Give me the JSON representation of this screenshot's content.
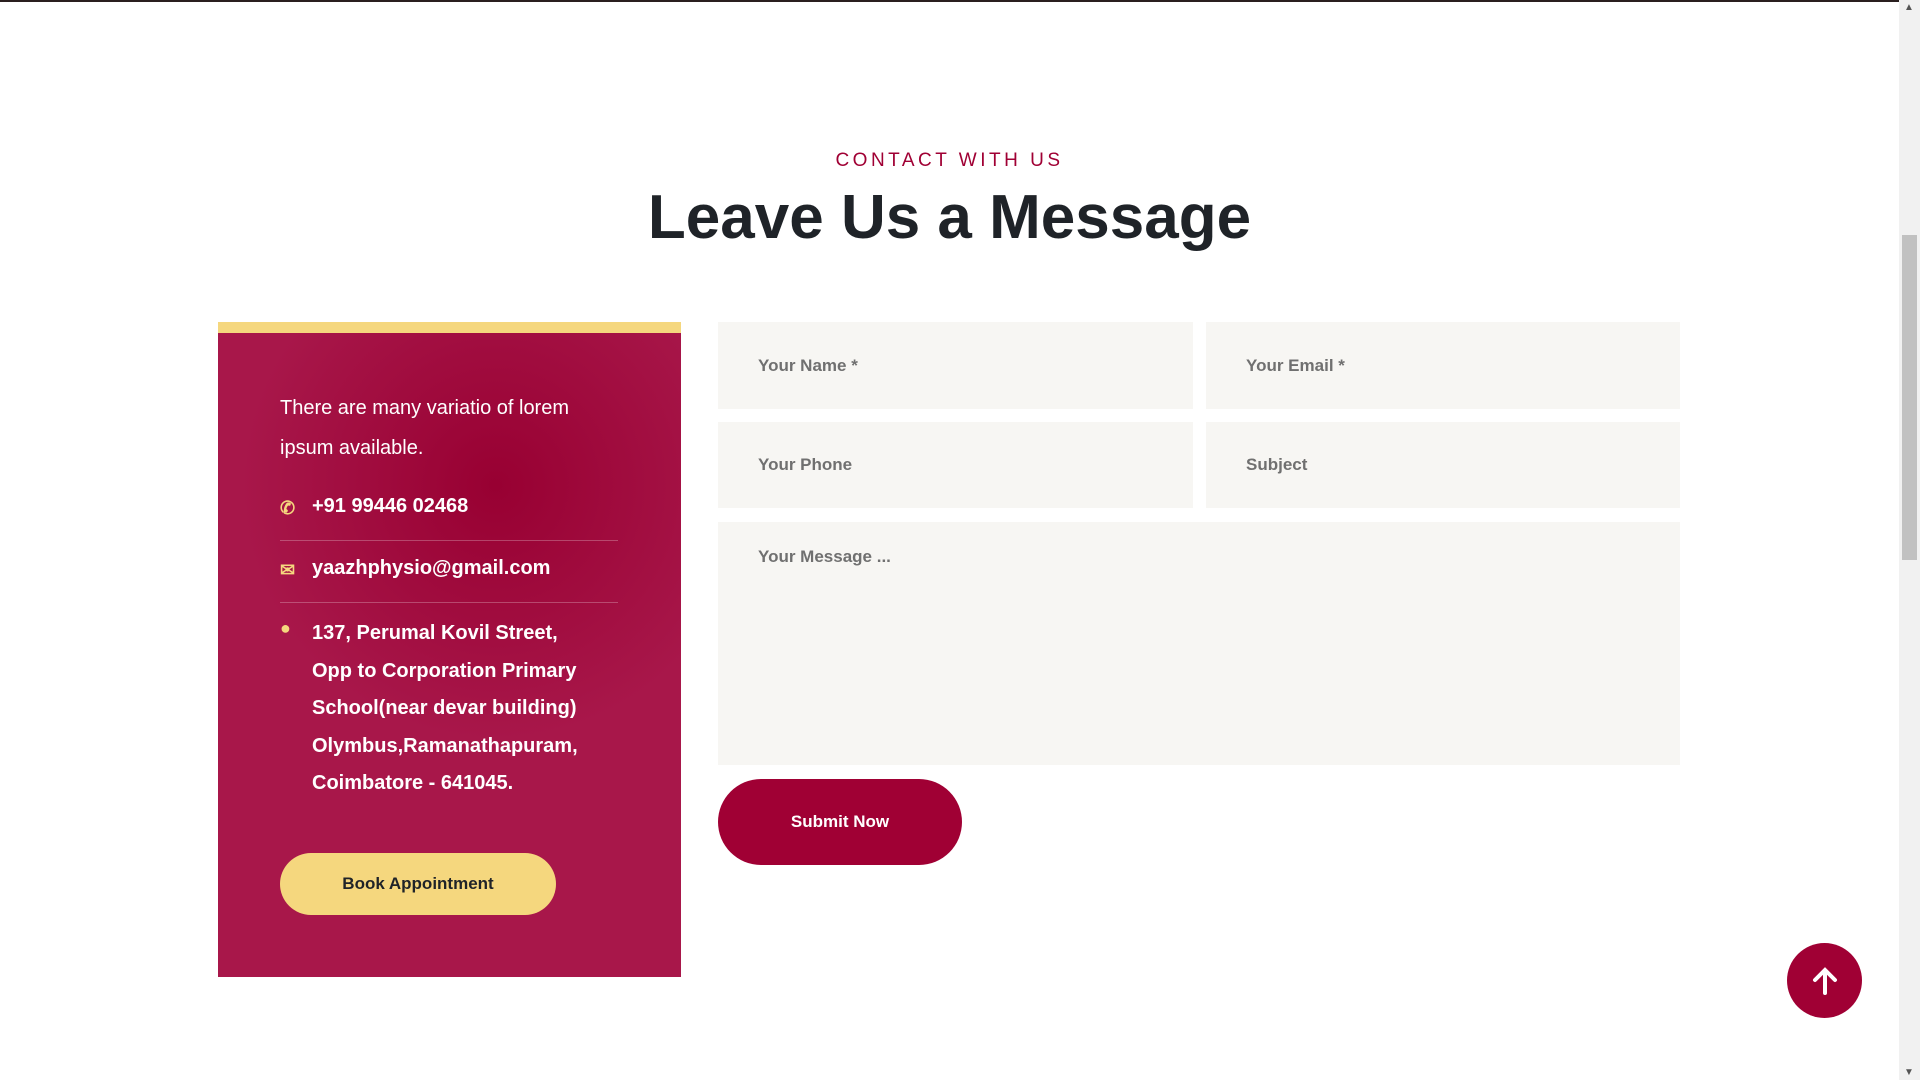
{
  "section": {
    "eyebrow": "CONTACT WITH US",
    "title": "Leave Us a Message"
  },
  "info": {
    "intro": "There are many variatio of lorem ipsum available.",
    "phone": "+91 99446 02468",
    "email": "yaazhphysio@gmail.com",
    "address": [
      "137, Perumal Kovil Street,",
      "Opp to Corporation Primary",
      "School(near devar building)",
      "Olymbus,Ramanathapuram,",
      "Coimbatore - 641045."
    ],
    "book_label": "Book Appointment"
  },
  "form": {
    "name_placeholder": "Your Name *",
    "email_placeholder": "Your Email *",
    "phone_placeholder": "Your Phone",
    "subject_placeholder": "Subject",
    "message_placeholder": "Your Message ...",
    "submit_label": "Submit Now"
  },
  "colors": {
    "accent": "#a00034",
    "panel": "#a8174a",
    "highlight": "#f5d77e",
    "field_bg": "#f7f6f3"
  }
}
